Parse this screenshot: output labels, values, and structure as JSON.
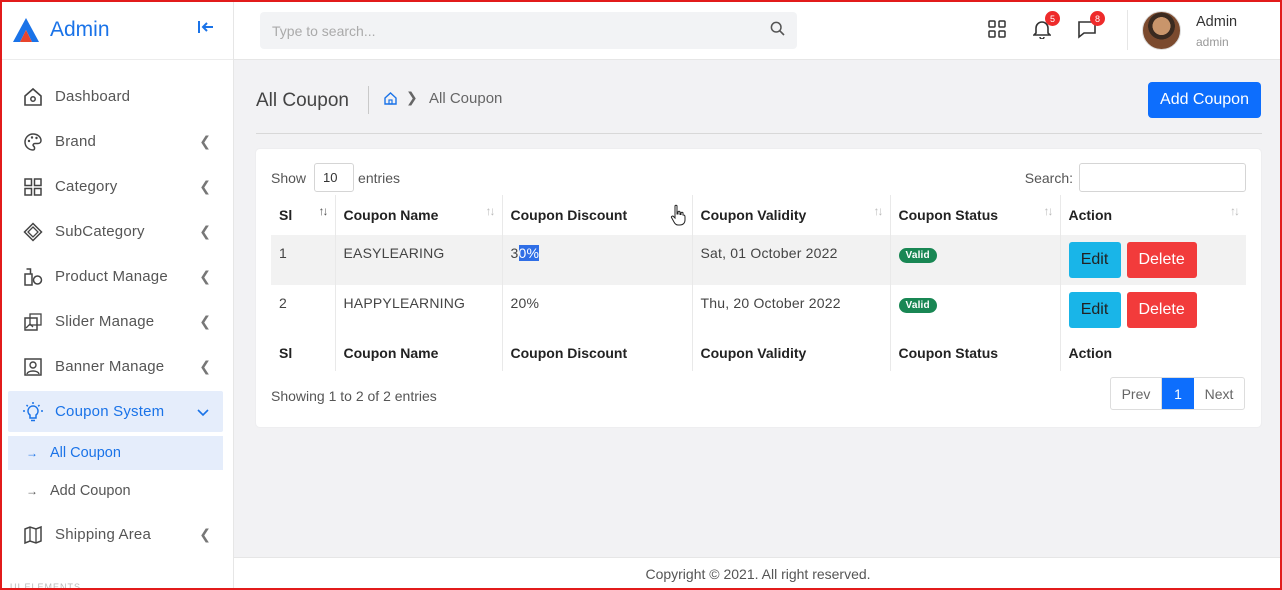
{
  "brand": {
    "name": "Admin",
    "accent": "#1a73e8"
  },
  "sidebar": {
    "items": [
      {
        "label": "Dashboard",
        "icon": "home-icon"
      },
      {
        "label": "Brand",
        "icon": "palette-icon"
      },
      {
        "label": "Category",
        "icon": "grid-icon"
      },
      {
        "label": "SubCategory",
        "icon": "cube-icon"
      },
      {
        "label": "Product Manage",
        "icon": "product-icon"
      },
      {
        "label": "Slider Manage",
        "icon": "images-icon"
      },
      {
        "label": "Banner Manage",
        "icon": "portrait-icon"
      },
      {
        "label": "Coupon System",
        "icon": "bulb-icon"
      },
      {
        "label": "Shipping Area",
        "icon": "map-icon"
      }
    ],
    "coupon_sub": [
      {
        "label": "All Coupon"
      },
      {
        "label": "Add Coupon"
      }
    ],
    "footer_label": "UI ELEMENTS"
  },
  "header": {
    "search_placeholder": "Type to search...",
    "notifications_count": "5",
    "messages_count": "8",
    "user_name": "Admin",
    "user_role": "admin"
  },
  "page": {
    "title": "All Coupon",
    "breadcrumb_current": "All Coupon",
    "add_button": "Add Coupon"
  },
  "table": {
    "show_label": "Show",
    "entries_value": "10",
    "entries_label": "entries",
    "search_label": "Search:",
    "columns": [
      "Sl",
      "Coupon Name",
      "Coupon Discount",
      "Coupon Validity",
      "Coupon Status",
      "Action"
    ],
    "rows": [
      {
        "sl": "1",
        "name": "EASYLEARING",
        "discount_pre": "3",
        "discount_sel": "0%",
        "validity": "Sat, 01 October 2022",
        "status": "Valid",
        "edit": "Edit",
        "delete": "Delete"
      },
      {
        "sl": "2",
        "name": "HAPPYLEARNING",
        "discount": "20%",
        "validity": "Thu, 20 October 2022",
        "status": "Valid",
        "edit": "Edit",
        "delete": "Delete"
      }
    ],
    "info": "Showing 1 to 2 of 2 entries",
    "pager": {
      "prev": "Prev",
      "current": "1",
      "next": "Next"
    }
  },
  "footer": {
    "text": "Copyright © 2021. All right reserved."
  },
  "colors": {
    "primary": "#0d6efd",
    "info": "#19b5e8",
    "danger": "#f23b3b",
    "success": "#198754"
  }
}
